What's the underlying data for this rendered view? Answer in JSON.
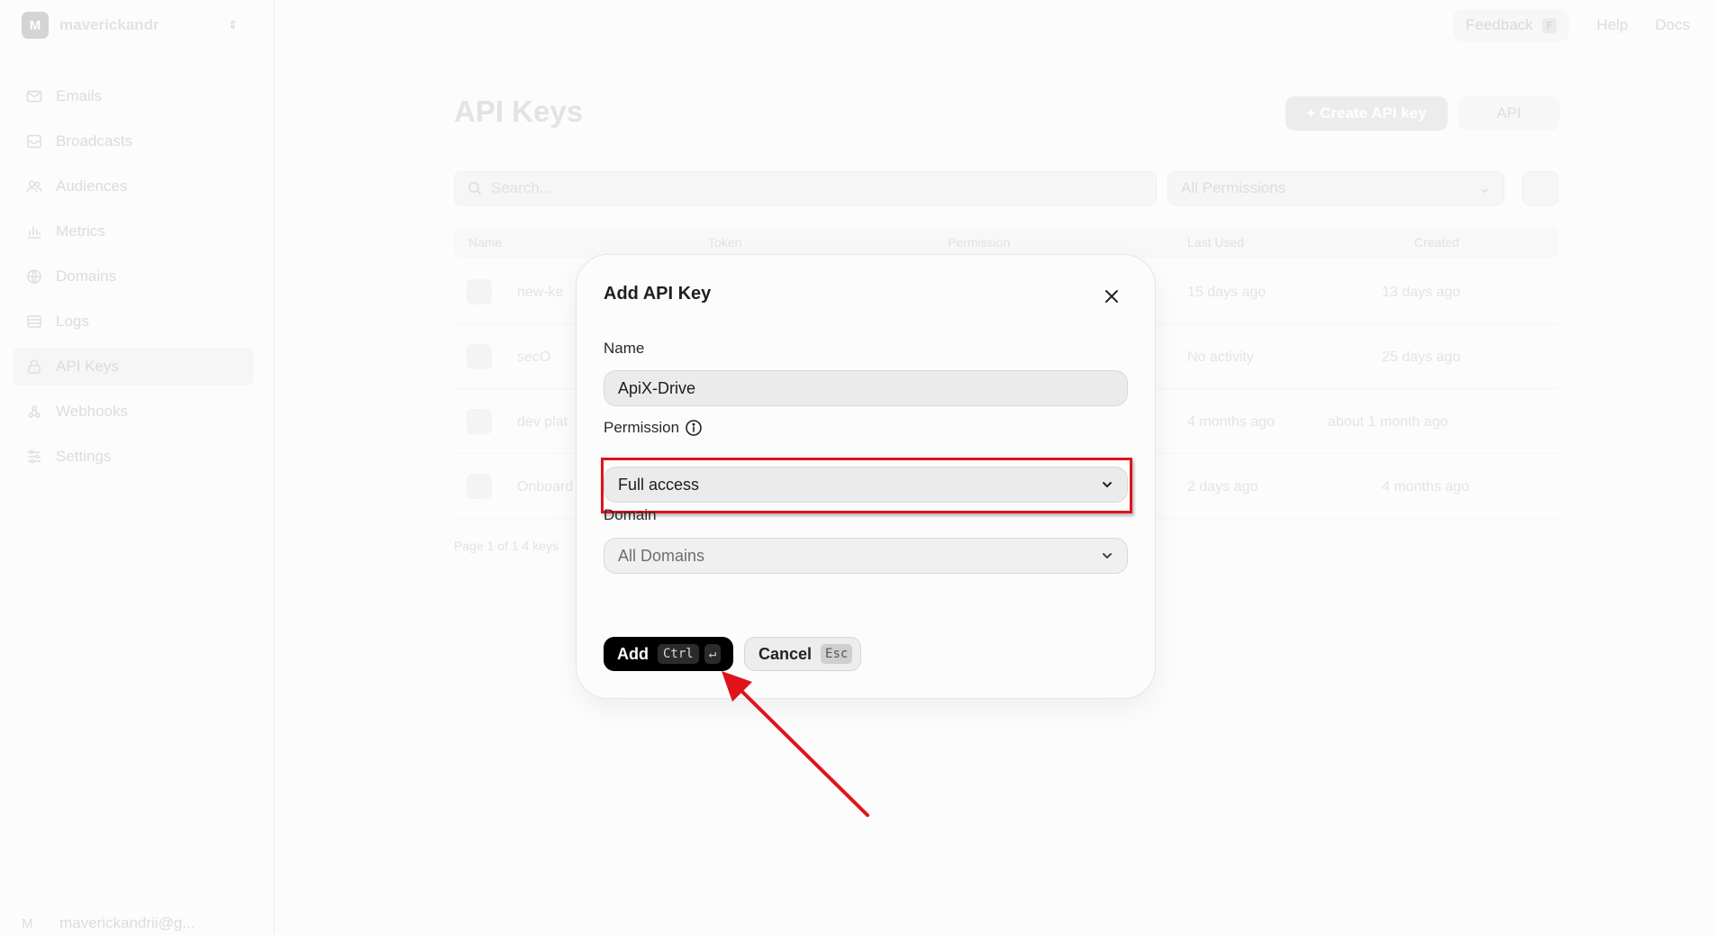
{
  "sidebar": {
    "team_initial": "M",
    "team_name": "maverickandr",
    "items": [
      {
        "label": "Emails",
        "icon": "mail-icon"
      },
      {
        "label": "Broadcasts",
        "icon": "broadcast-icon"
      },
      {
        "label": "Audiences",
        "icon": "users-icon"
      },
      {
        "label": "Metrics",
        "icon": "chart-icon"
      },
      {
        "label": "Domains",
        "icon": "globe-icon"
      },
      {
        "label": "Logs",
        "icon": "list-icon"
      },
      {
        "label": "API Keys",
        "icon": "lock-icon",
        "active": true
      },
      {
        "label": "Webhooks",
        "icon": "webhook-icon"
      },
      {
        "label": "Settings",
        "icon": "sliders-icon"
      }
    ],
    "account_initial": "M",
    "account_email": "maverickandrii@g..."
  },
  "topbar": {
    "feedback": "Feedback",
    "feedback_key": "F",
    "help": "Help",
    "docs": "Docs"
  },
  "page": {
    "title": "API Keys",
    "create_button": "+ Create API key",
    "api_button": "API",
    "search_placeholder": "Search...",
    "permission_filter": "All Permissions",
    "columns": [
      "Name",
      "Token",
      "Permission",
      "Last Used",
      "Created"
    ],
    "rows": [
      {
        "name": "new-ke",
        "last_used": "15 days ago",
        "created": "13 days ago"
      },
      {
        "name": "secO",
        "last_used": "No activity",
        "created": "25 days ago"
      },
      {
        "name": "dev plat",
        "last_used": "4 months ago",
        "created": "about 1 month ago"
      },
      {
        "name": "Onboard",
        "last_used": "2 days ago",
        "created": "4 months ago"
      }
    ],
    "pager": "Page 1 of 1 4 keys"
  },
  "modal": {
    "title": "Add API Key",
    "name_label": "Name",
    "name_value": "ApiX-Drive",
    "permission_label": "Permission",
    "permission_value": "Full access",
    "domain_label": "Domain",
    "domain_value": "All Domains",
    "add_label": "Add",
    "add_key1": "Ctrl",
    "add_key2": "↵",
    "cancel_label": "Cancel",
    "cancel_key": "Esc"
  },
  "colors": {
    "highlight": "#e0131b",
    "primary_button": "#000000"
  }
}
